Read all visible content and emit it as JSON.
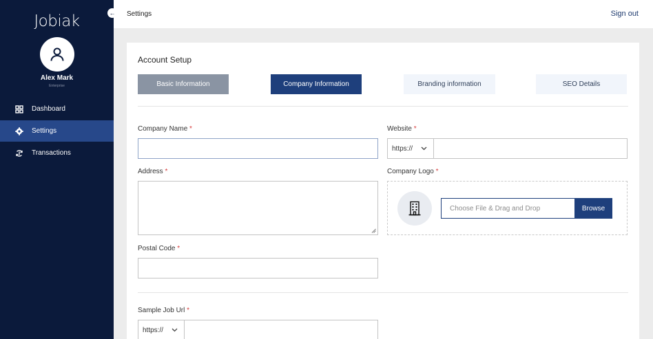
{
  "app": {
    "brand": "Jobiak"
  },
  "user": {
    "name": "Alex Mark",
    "role": "Enterprise"
  },
  "sidebar": {
    "items": [
      {
        "label": "Dashboard",
        "icon": "dashboard-icon",
        "active": false
      },
      {
        "label": "Settings",
        "icon": "gear-icon",
        "active": true
      },
      {
        "label": "Transactions",
        "icon": "transactions-icon",
        "active": false
      }
    ]
  },
  "header": {
    "title": "Settings",
    "signout": "Sign out"
  },
  "account": {
    "title": "Account Setup",
    "tabs": [
      {
        "label": "Basic Information",
        "state": "completed"
      },
      {
        "label": "Company Information",
        "state": "active"
      },
      {
        "label": "Branding information",
        "state": "inactive"
      },
      {
        "label": "SEO Details",
        "state": "inactive"
      }
    ]
  },
  "form": {
    "company_name": {
      "label": "Company Name",
      "required": "*",
      "value": ""
    },
    "website": {
      "label": "Website",
      "required": "*",
      "protocol": "https://",
      "value": ""
    },
    "address": {
      "label": "Address",
      "required": "*",
      "value": ""
    },
    "company_logo": {
      "label": "Company Logo",
      "required": "*",
      "placeholder": "Choose File & Drag and Drop",
      "browse": "Browse"
    },
    "postal_code": {
      "label": "Postal Code",
      "required": "*",
      "value": ""
    },
    "sample_job_url": {
      "label": "Sample Job Url",
      "required": "*",
      "protocol": "https://",
      "value": ""
    }
  },
  "colors": {
    "sidebar_bg": "#0b1a3b",
    "sidebar_active": "#27488a",
    "primary": "#1e3f7c",
    "tab_completed": "#8a94a3",
    "required": "#d63b3b"
  }
}
